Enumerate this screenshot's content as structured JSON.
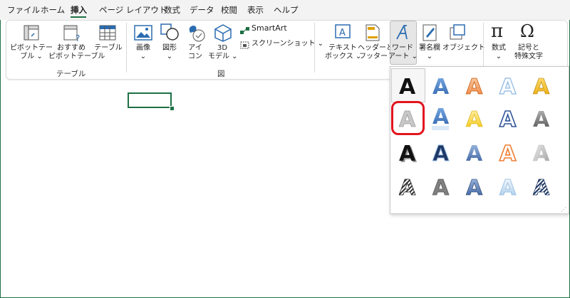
{
  "tabs": [
    "ファイル",
    "ホーム",
    "挿入",
    "ページ レイアウト",
    "数式",
    "データ",
    "校閲",
    "表示",
    "ヘルプ"
  ],
  "active_tab": "挿入",
  "ribbon": {
    "pivot_table": {
      "line1": "ピボットテー",
      "line2": "ブル ⌄"
    },
    "recommended_pivot": {
      "line1": "おすすめ",
      "line2": "ピボットテーブル"
    },
    "table": {
      "line1": "テーブル"
    },
    "group_table": "テーブル",
    "images": {
      "line1": "画像",
      "line2": "⌄"
    },
    "shapes": {
      "line1": "図形",
      "line2": "⌄"
    },
    "icons": {
      "line1": "アイ",
      "line2": "コン"
    },
    "model3d": {
      "line1": "3D",
      "line2": "モデル ⌄"
    },
    "smartart": "SmartArt",
    "screenshot": "スクリーンショット ⌄",
    "group_illust": "図",
    "textbox": {
      "line1": "テキスト",
      "line2": "ボックス ⌄"
    },
    "header_footer": {
      "line1": "ヘッダーと",
      "line2": "フッター"
    },
    "wordart": {
      "line1": "ワード",
      "line2": "アート ⌄"
    },
    "signature": {
      "line1": "署名欄",
      "line2": "⌄"
    },
    "object": {
      "line1": "オブジェクト"
    },
    "equation": {
      "line1": "数式",
      "line2": "⌄"
    },
    "symbol": {
      "line1": "記号と",
      "line2": "特殊文字"
    },
    "equation_glyph": "π",
    "symbol_glyph": "Ω"
  },
  "wordart_gallery": {
    "glyph": "A",
    "selected_style_index": 5
  },
  "colors": {
    "accent": "#1e7145",
    "highlight": "#e2141f"
  }
}
